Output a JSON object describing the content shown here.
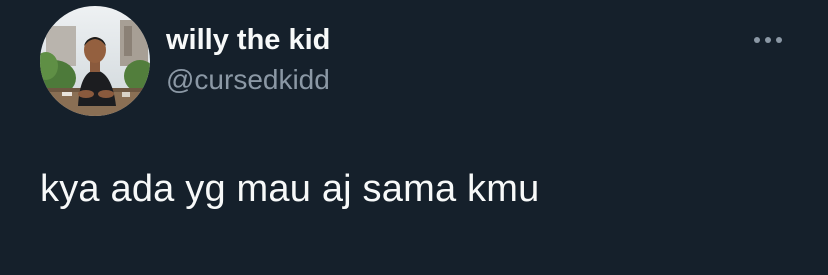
{
  "tweet": {
    "author": {
      "display_name": "willy the kid",
      "handle": "@cursedkidd",
      "avatar_icon": "profile-photo"
    },
    "more_icon": "more-horizontal-icon",
    "text": "kya ada yg mau aj sama kmu"
  },
  "colors": {
    "background": "#15202b",
    "primary_text": "#f7f9f9",
    "secondary_text": "#8b98a5"
  }
}
